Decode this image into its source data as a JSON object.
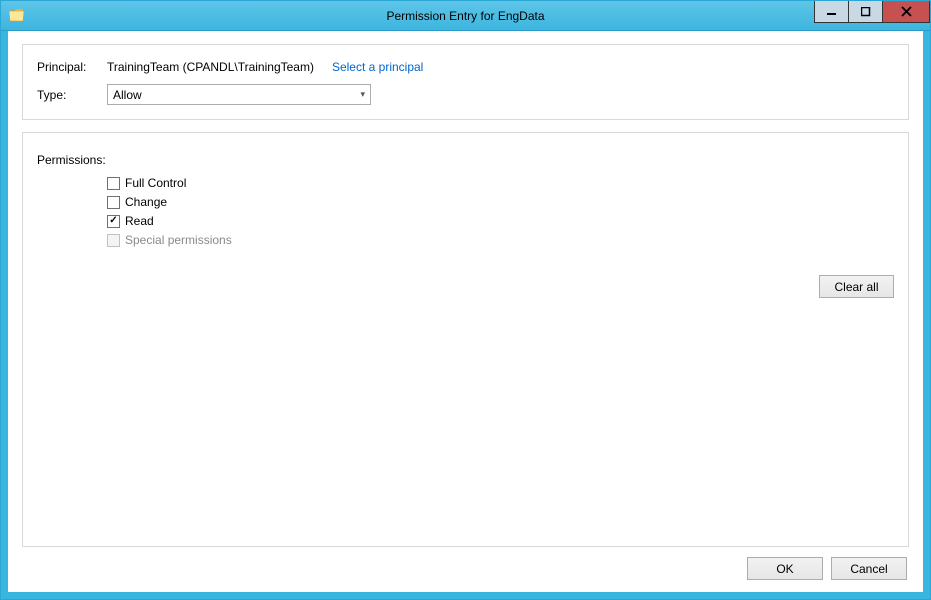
{
  "window": {
    "title": "Permission Entry for EngData"
  },
  "top": {
    "principal_label": "Principal:",
    "principal_value": "TrainingTeam (CPANDL\\TrainingTeam)",
    "select_principal_link": "Select a principal",
    "type_label": "Type:",
    "type_value": "Allow"
  },
  "permissions": {
    "heading": "Permissions:",
    "items": [
      {
        "label": "Full Control",
        "checked": false,
        "disabled": false
      },
      {
        "label": "Change",
        "checked": false,
        "disabled": false
      },
      {
        "label": "Read",
        "checked": true,
        "disabled": false
      },
      {
        "label": "Special permissions",
        "checked": false,
        "disabled": true
      }
    ],
    "clear_all_label": "Clear all"
  },
  "buttons": {
    "ok": "OK",
    "cancel": "Cancel"
  }
}
